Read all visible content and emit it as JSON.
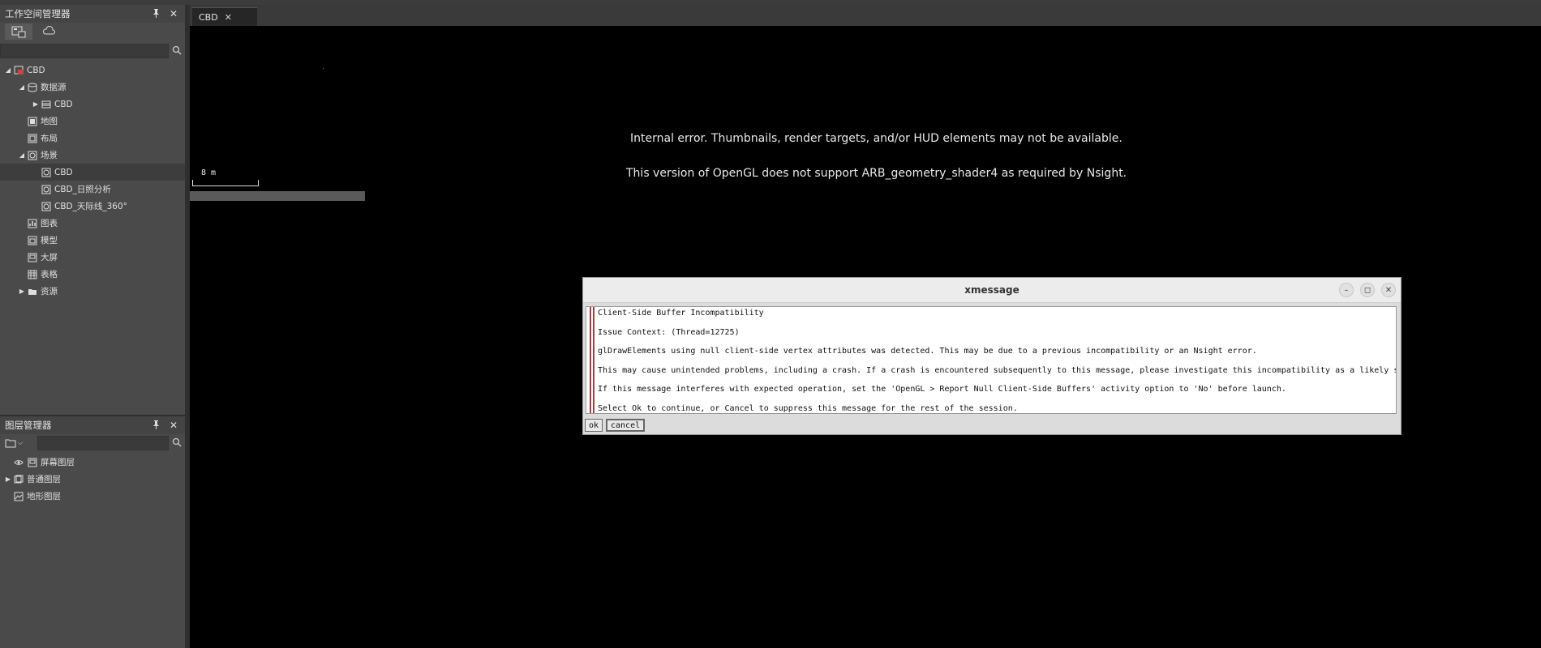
{
  "workspace": {
    "title": "工作空间管理器",
    "tree": [
      {
        "label": "CBD",
        "icon": "workspace-icon",
        "expander": "expanded"
      },
      {
        "label": "数据源",
        "icon": "datasource-icon",
        "expander": "expanded"
      },
      {
        "label": "CBD",
        "icon": "database-icon",
        "expander": "collapsed"
      },
      {
        "label": "地图",
        "icon": "map-icon",
        "expander": ""
      },
      {
        "label": "布局",
        "icon": "layout-icon",
        "expander": ""
      },
      {
        "label": "场景",
        "icon": "scene-icon",
        "expander": "expanded"
      },
      {
        "label": "CBD",
        "icon": "scene-item-icon",
        "expander": "",
        "selected": true
      },
      {
        "label": "CBD_日照分析",
        "icon": "scene-item-icon",
        "expander": ""
      },
      {
        "label": "CBD_天际线_360°",
        "icon": "scene-item-icon",
        "expander": ""
      },
      {
        "label": "图表",
        "icon": "chart-icon",
        "expander": ""
      },
      {
        "label": "模型",
        "icon": "model-icon",
        "expander": ""
      },
      {
        "label": "大屏",
        "icon": "screen-icon",
        "expander": ""
      },
      {
        "label": "表格",
        "icon": "table-icon",
        "expander": ""
      },
      {
        "label": "资源",
        "icon": "folder-icon",
        "expander": "collapsed"
      }
    ]
  },
  "layer_manager": {
    "title": "图层管理器",
    "layers": [
      {
        "label": "屏幕图层",
        "expander": "",
        "visible": true
      },
      {
        "label": "普通图层",
        "expander": "collapsed",
        "visible": false
      },
      {
        "label": "地形图层",
        "expander": "",
        "visible": false
      }
    ]
  },
  "document": {
    "tab_label": "CBD"
  },
  "viewport": {
    "error1": "Internal error. Thumbnails, render targets, and/or HUD elements may not be available.",
    "error2": "This version of OpenGL does not support ARB_geometry_shader4 as required by Nsight.",
    "scale": "8 m"
  },
  "dialog": {
    "title": "xmessage",
    "lines": [
      "Client-Side Buffer Incompatibility",
      "Issue Context: (Thread=12725)",
      "glDrawElements using null client-side vertex attributes was detected. This may be due to a previous incompatibility or an Nsight error.",
      "This may cause unintended problems, including a crash. If a crash is encountered subsequently to this message, please investigate this incompatibility as a likely sourc",
      "If this message interferes with expected operation, set the 'OpenGL > Report Null Client-Side Buffers' activity option to 'No' before launch.",
      "Select Ok to continue, or Cancel to suppress this message for the rest of the session."
    ],
    "ok_label": "ok",
    "cancel_label": "cancel"
  }
}
